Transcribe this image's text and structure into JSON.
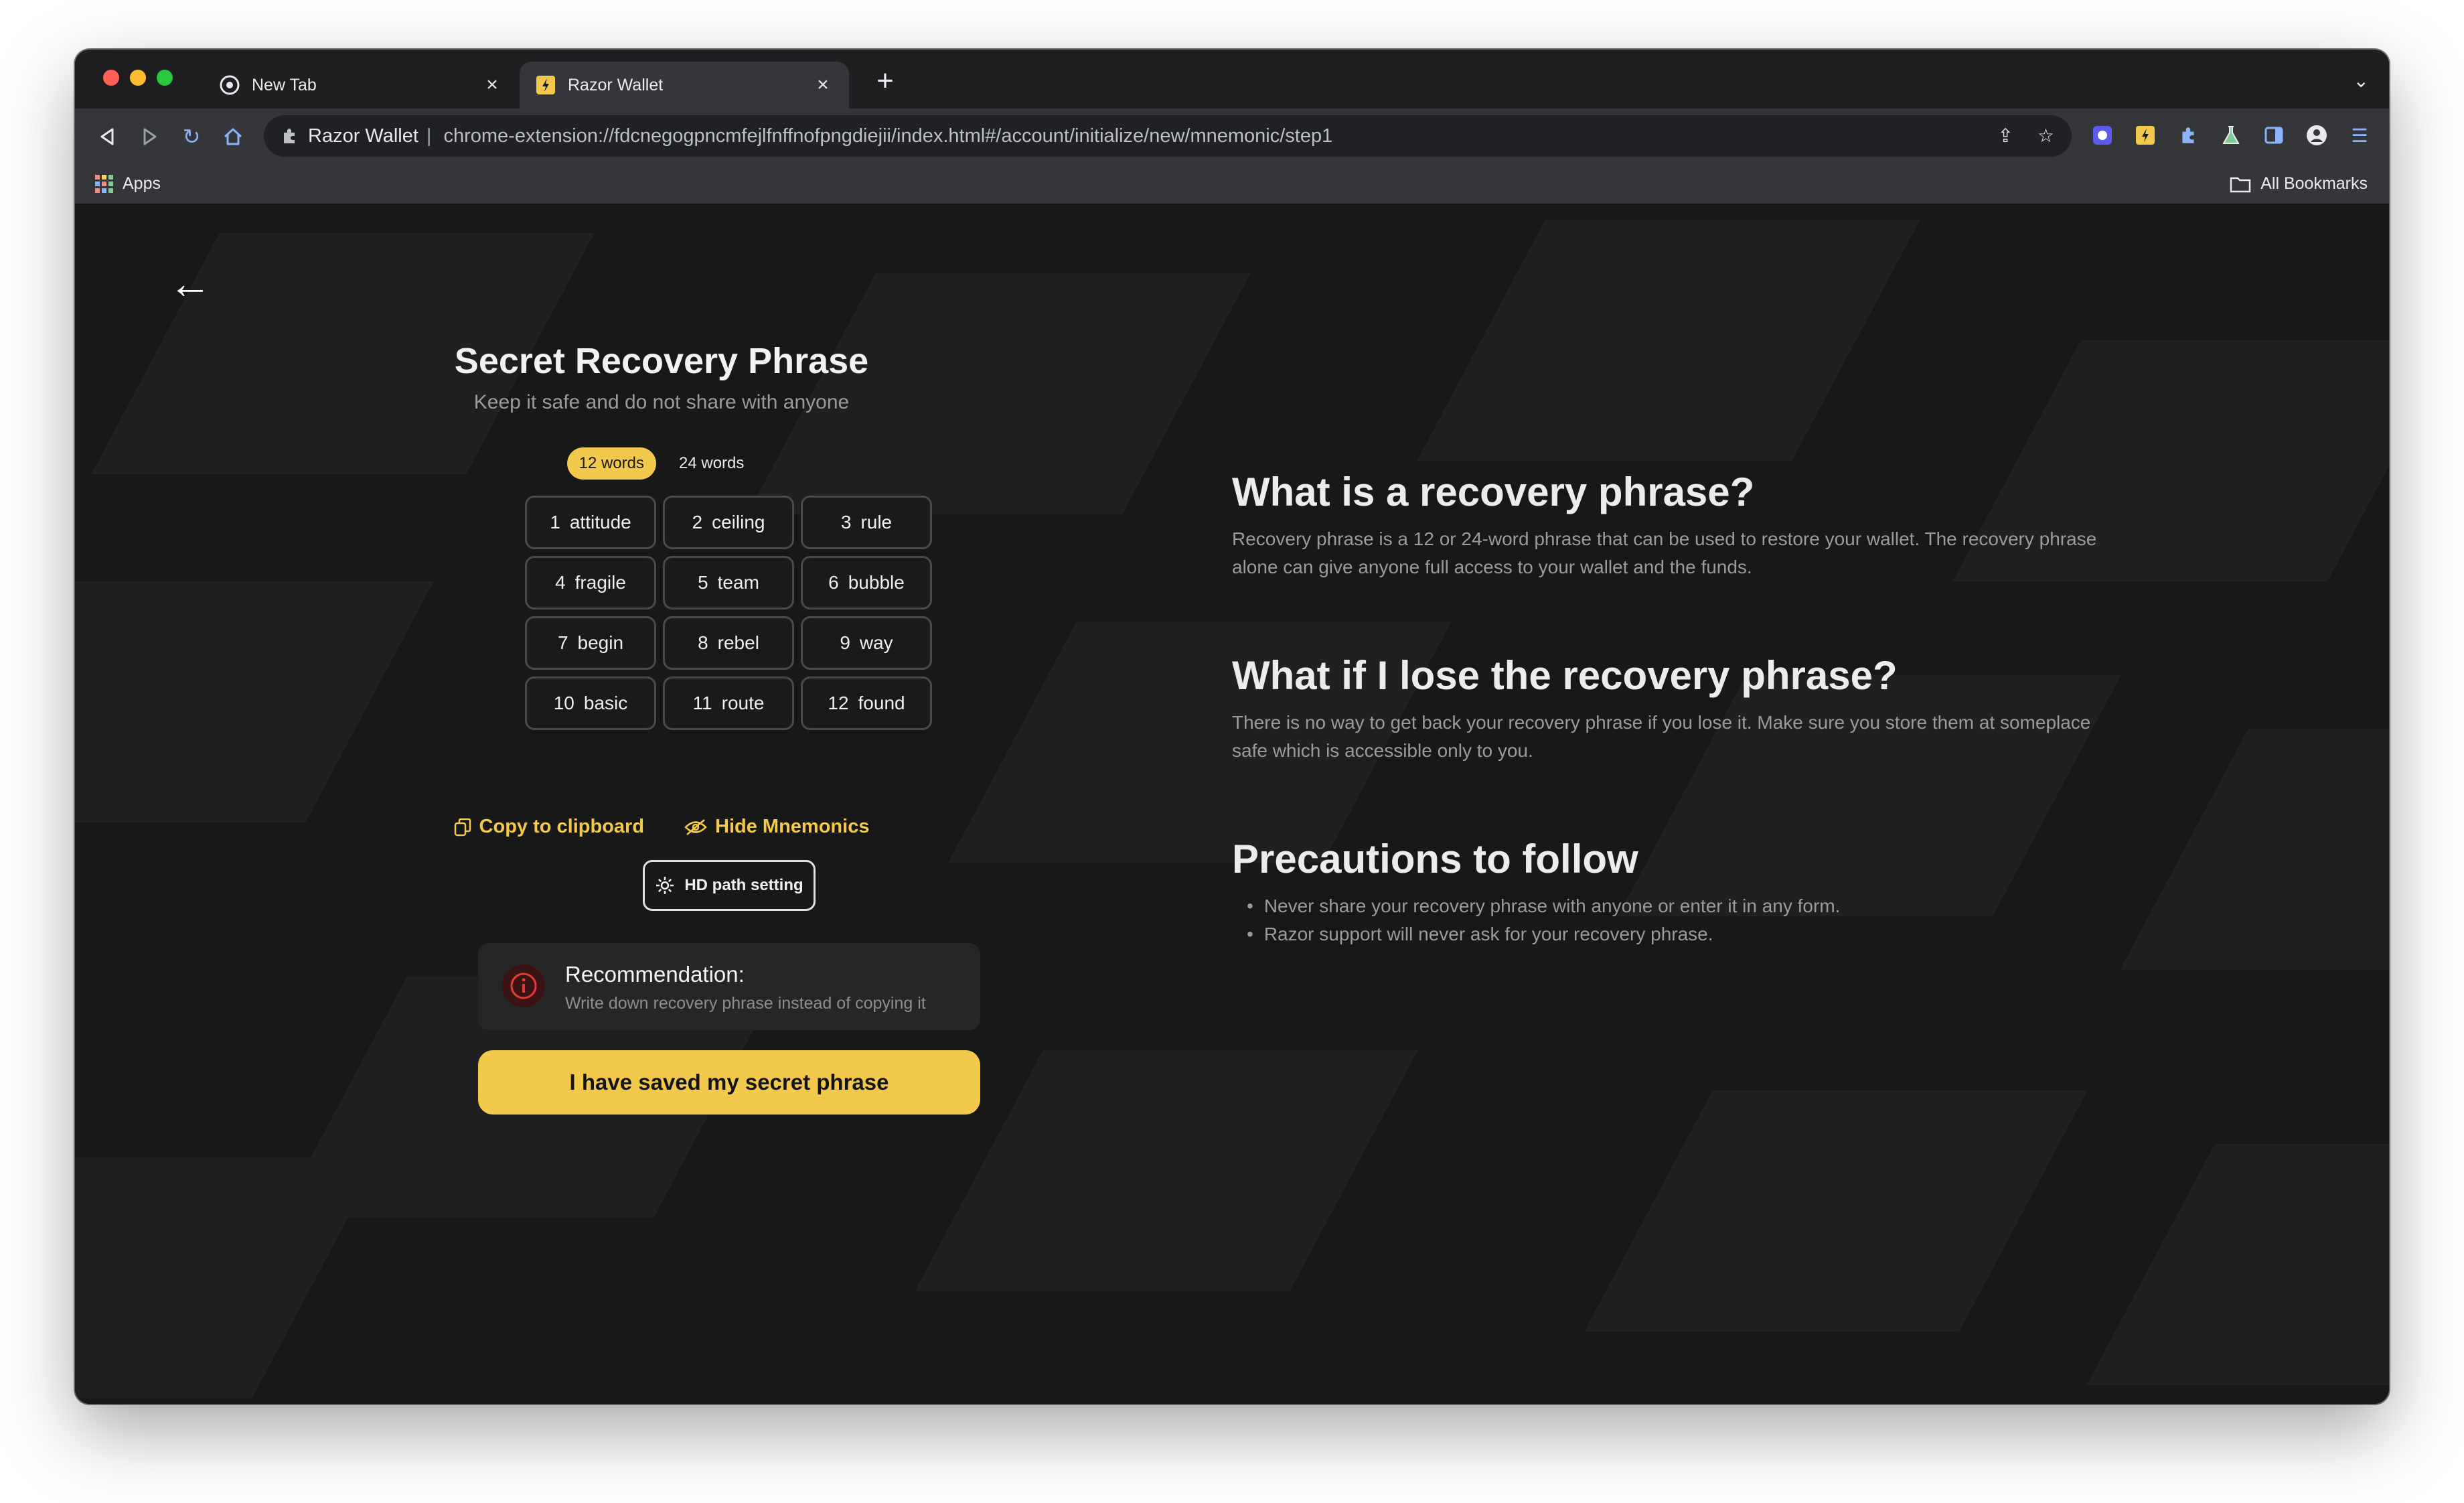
{
  "browser": {
    "tabs": [
      {
        "title": "New Tab",
        "active": false,
        "favicon": "chrome-icon"
      },
      {
        "title": "Razor Wallet",
        "active": true,
        "favicon": "razor-wallet-icon"
      }
    ],
    "omnibox": {
      "extension_label": "Razor Wallet",
      "url": "chrome-extension://fdcnegogpncmfejlfnffnofpngdiejii/index.html#/account/initialize/new/mnemonic/step1"
    },
    "bookmarks": {
      "apps_label": "Apps",
      "all_bookmarks_label": "All Bookmarks"
    }
  },
  "mnemonic": {
    "title": "Secret Recovery Phrase",
    "subtitle": "Keep it safe and do not share with anyone",
    "toggle": {
      "option_12": "12 words",
      "option_24": "24 words",
      "selected": "12 words"
    },
    "words": [
      {
        "n": "1",
        "w": "attitude"
      },
      {
        "n": "2",
        "w": "ceiling"
      },
      {
        "n": "3",
        "w": "rule"
      },
      {
        "n": "4",
        "w": "fragile"
      },
      {
        "n": "5",
        "w": "team"
      },
      {
        "n": "6",
        "w": "bubble"
      },
      {
        "n": "7",
        "w": "begin"
      },
      {
        "n": "8",
        "w": "rebel"
      },
      {
        "n": "9",
        "w": "way"
      },
      {
        "n": "10",
        "w": "basic"
      },
      {
        "n": "11",
        "w": "route"
      },
      {
        "n": "12",
        "w": "found"
      }
    ],
    "copy_label": "Copy to clipboard",
    "hide_label": "Hide Mnemonics",
    "hd_path_label": "HD path setting",
    "recommendation": {
      "title": "Recommendation:",
      "text": "Write down recovery phrase instead of copying it"
    },
    "confirm_button": "I have saved my secret phrase"
  },
  "info": {
    "sections": [
      {
        "heading": "What is a recovery phrase?",
        "body": "Recovery phrase is a 12 or 24-word phrase that can be used to restore your wallet. The recovery phrase alone can give anyone full access to your wallet and the funds."
      },
      {
        "heading": "What if I lose the recovery phrase?",
        "body": "There is no way to get back your recovery phrase if you lose it. Make sure you store them at someplace safe which is accessible only to you."
      },
      {
        "heading": "Precautions to follow",
        "bullets": [
          "Never share your recovery phrase with anyone or enter it in any form.",
          "Razor support will never ask for your recovery phrase."
        ]
      }
    ]
  },
  "colors": {
    "accent": "#f2c94c",
    "background": "#181818",
    "card": "#262626"
  }
}
